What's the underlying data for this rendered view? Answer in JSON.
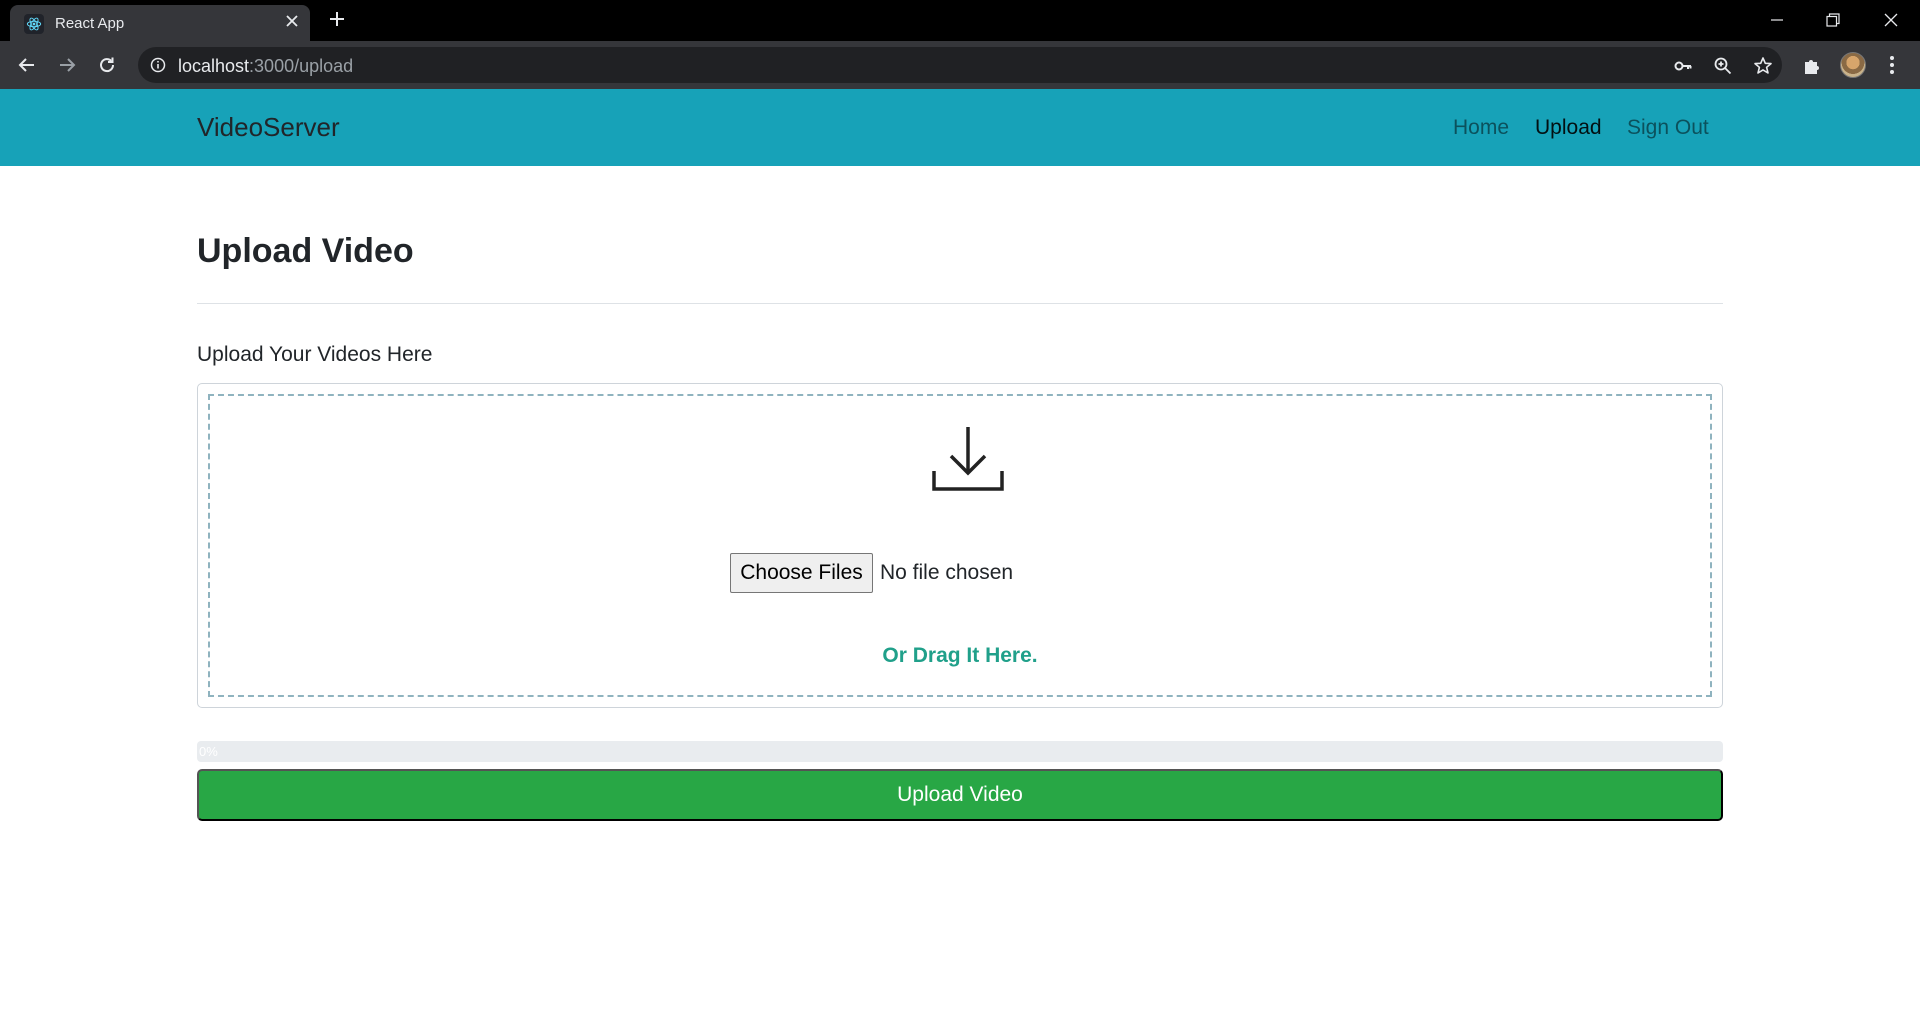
{
  "browser": {
    "tab_title": "React App",
    "url_host": "localhost",
    "url_rest": ":3000/upload",
    "icons": [
      "react-favicon",
      "close-icon",
      "plus-icon",
      "minimize-icon",
      "restore-icon",
      "close-window-icon",
      "back-arrow-icon",
      "forward-arrow-icon",
      "reload-icon",
      "info-icon",
      "key-icon",
      "zoom-icon",
      "star-icon",
      "puzzle-icon",
      "profile-avatar",
      "kebab-menu-icon"
    ]
  },
  "navbar": {
    "brand": "VideoServer",
    "links": [
      {
        "label": "Home",
        "active": false
      },
      {
        "label": "Upload",
        "active": true
      },
      {
        "label": "Sign Out",
        "active": false
      }
    ],
    "background": "#17a2b8"
  },
  "main": {
    "title": "Upload Video",
    "section_label": "Upload Your Videos Here",
    "dropzone": {
      "icon": "download-icon",
      "choose_button": "Choose Files",
      "file_status": "No file chosen",
      "drag_text": "Or Drag It Here."
    },
    "progress": {
      "value": 0,
      "label": "0%"
    },
    "upload_button": "Upload Video",
    "colors": {
      "upload_button": "#28a745",
      "drag_text": "#20a08a"
    }
  }
}
